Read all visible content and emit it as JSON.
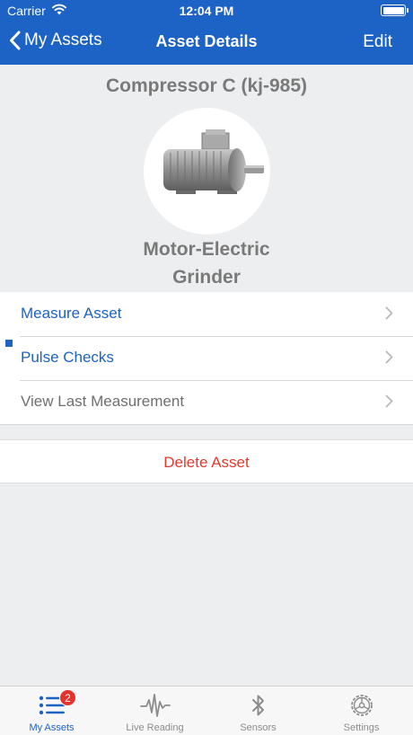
{
  "status_bar": {
    "carrier": "Carrier",
    "time": "12:04 PM"
  },
  "nav": {
    "back_label": "My Assets",
    "title": "Asset Details",
    "edit_label": "Edit"
  },
  "asset": {
    "name": "Compressor C (kj-985)",
    "type_line1": "Motor-Electric",
    "type_line2": "Grinder"
  },
  "menu": {
    "items": [
      {
        "label": "Measure Asset"
      },
      {
        "label": "Pulse Checks"
      },
      {
        "label": "View Last Measurement"
      }
    ]
  },
  "delete_label": "Delete Asset",
  "tabs": [
    {
      "label": "My Assets",
      "icon": "list-icon",
      "badge": "2",
      "active": true
    },
    {
      "label": "Live Reading",
      "icon": "waveform-icon"
    },
    {
      "label": "Sensors",
      "icon": "bluetooth-icon"
    },
    {
      "label": "Settings",
      "icon": "gear-icon"
    }
  ],
  "colors": {
    "accent": "#1d62c5",
    "destructive": "#e23a2e",
    "badge": "#e5322d",
    "background": "#eceeef"
  }
}
